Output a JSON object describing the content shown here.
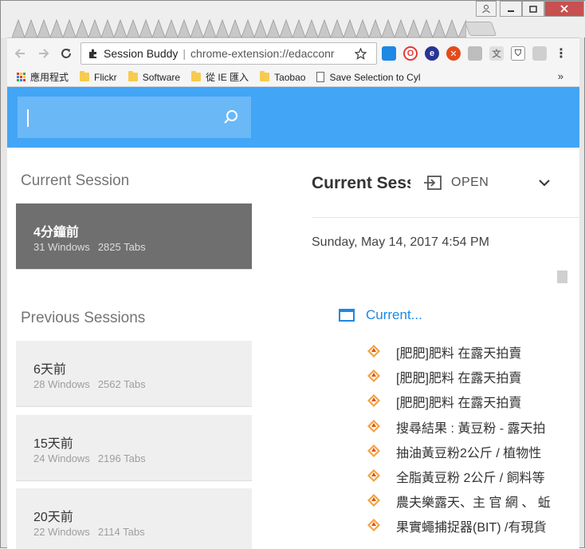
{
  "browser": {
    "tab_title": "Session Buddy",
    "url": "chrome-extension://edacconr",
    "nav": {
      "back_icon": "arrow-left-icon",
      "forward_icon": "arrow-right-icon",
      "reload_icon": "reload-icon"
    }
  },
  "bookmarks": [
    {
      "label": "應用程式",
      "icon": "apps-icon"
    },
    {
      "label": "Flickr",
      "icon": "folder-icon"
    },
    {
      "label": "Software",
      "icon": "folder-icon"
    },
    {
      "label": "從 IE 匯入",
      "icon": "folder-icon"
    },
    {
      "label": "Taobao",
      "icon": "folder-icon"
    },
    {
      "label": "Save Selection to Cyl",
      "icon": "page-icon"
    }
  ],
  "bookmarks_more": "»",
  "search": {
    "placeholder": ""
  },
  "left": {
    "current_heading": "Current Session",
    "current": {
      "title": "4分鐘前",
      "windows": "31 Windows",
      "tabs": "2825 Tabs"
    },
    "previous_heading": "Previous Sessions",
    "previous": [
      {
        "title": "6天前",
        "windows": "28 Windows",
        "tabs": "2562 Tabs"
      },
      {
        "title": "15天前",
        "windows": "24 Windows",
        "tabs": "2196 Tabs"
      },
      {
        "title": "20天前",
        "windows": "22 Windows",
        "tabs": "2114 Tabs"
      }
    ]
  },
  "right": {
    "title": "Current Session",
    "open_label": "OPEN",
    "date": "Sunday, May 14, 2017 4:54 PM",
    "window_label": "Current...",
    "tabs": [
      "[肥肥]肥料 在露天拍賣",
      "[肥肥]肥料 在露天拍賣",
      "[肥肥]肥料 在露天拍賣",
      "搜尋結果 : 黃豆粉 - 露天拍",
      "抽油黃豆粉2公斤 / 植物性",
      "全脂黃豆粉 2公斤 / 飼料等",
      "農夫樂露天、主 官 網 、 蚯",
      "果實蠅捕捉器(BIT) /有現貨"
    ]
  },
  "colors": {
    "accent": "#42a5f5",
    "active_card": "#6f6f6f",
    "link": "#1e88e5"
  }
}
